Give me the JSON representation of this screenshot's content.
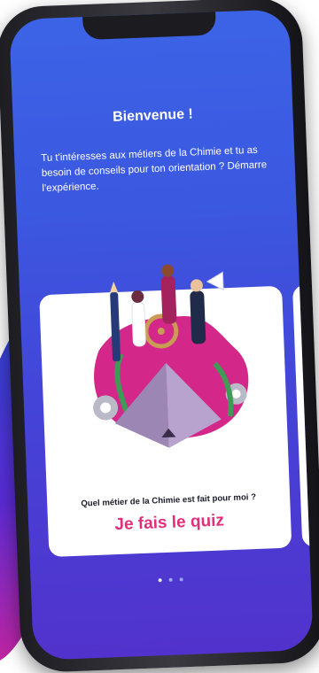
{
  "welcome": {
    "title": "Bienvenue !",
    "text": "Tu t'intéresses aux métiers de la Chimie et tu as besoin de conseils pour ton orientation ? Démarre l'expérience."
  },
  "card": {
    "question": "Quel métier de la Chimie est fait pour moi ?",
    "cta": "Je fais le quiz"
  },
  "carousel": {
    "count": 3,
    "active": 1
  },
  "colors": {
    "screen_top": "#3c63e6",
    "screen_bottom": "#5232cc",
    "cta": "#e0307c",
    "blob": "#d4278a"
  }
}
